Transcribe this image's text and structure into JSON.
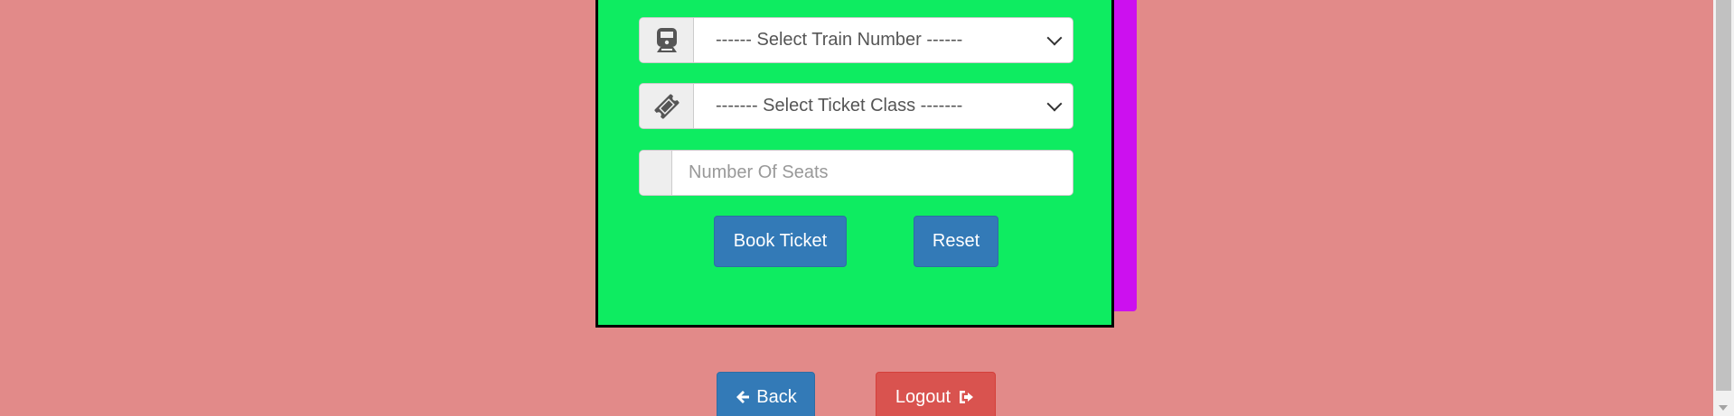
{
  "form": {
    "train_select": {
      "icon": "train-icon",
      "selected": "------ Select Train Number ------"
    },
    "class_select": {
      "icon": "ticket-icon",
      "selected": "------- Select Ticket Class -------"
    },
    "seats_input": {
      "placeholder": "Number Of Seats",
      "value": ""
    },
    "book_label": "Book Ticket",
    "reset_label": "Reset"
  },
  "footer": {
    "back_label": "Back",
    "back_icon": "arrow-left-icon",
    "logout_label": "Logout",
    "logout_icon": "sign-out-icon"
  },
  "colors": {
    "background": "#e28a89",
    "card": "#0eec61",
    "panel_accent": "#cc10ef",
    "primary": "#337ab7",
    "danger": "#d9534f"
  }
}
